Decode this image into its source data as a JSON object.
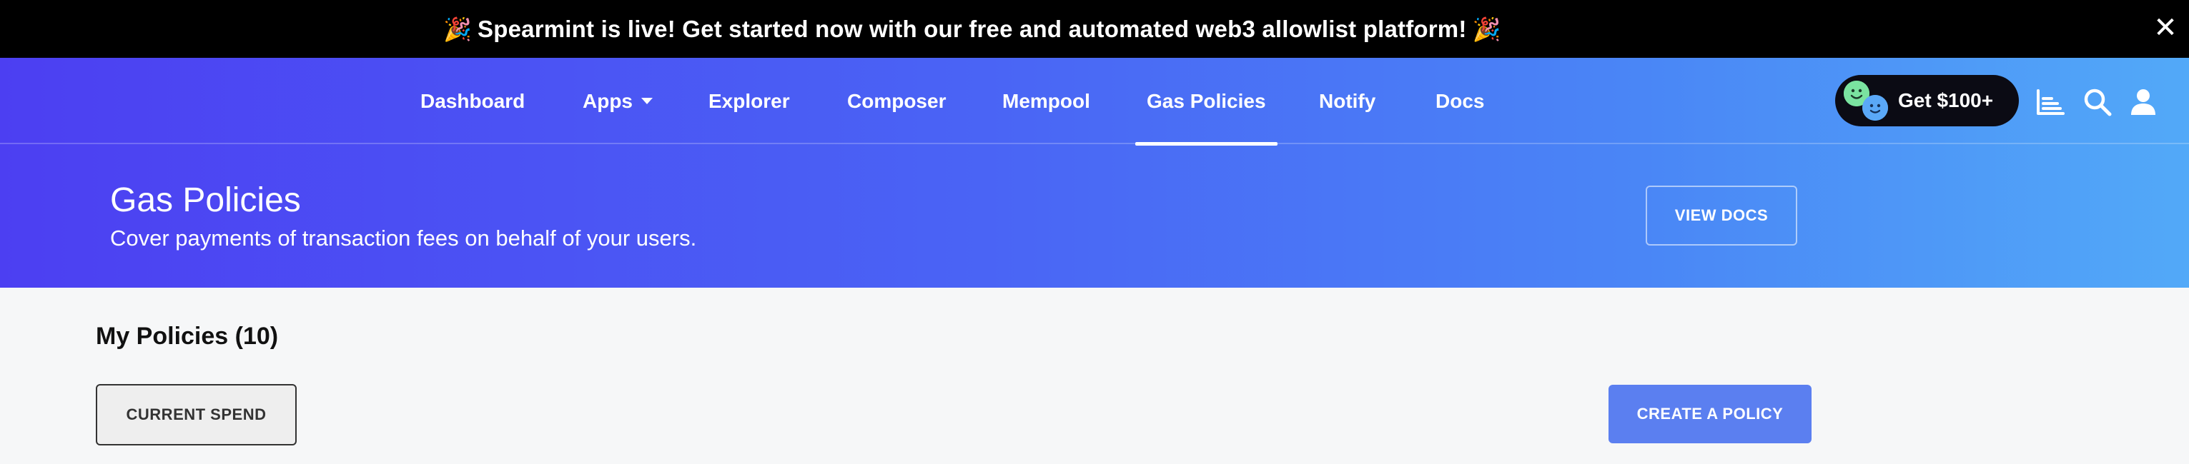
{
  "announcement": {
    "party_emoji": "🎉",
    "text": "Spearmint is live! Get started now with our free and automated web3 allowlist platform!",
    "close_glyph": "✕"
  },
  "nav": {
    "items": [
      {
        "label": "Dashboard"
      },
      {
        "label": "Apps"
      },
      {
        "label": "Explorer"
      },
      {
        "label": "Composer"
      },
      {
        "label": "Mempool"
      },
      {
        "label": "Gas Policies",
        "active": true
      },
      {
        "label": "Notify"
      },
      {
        "label": "Docs"
      }
    ],
    "promo_label": "Get $100+",
    "icons": [
      "chart-icon",
      "search-icon",
      "user-icon"
    ]
  },
  "hero": {
    "title": "Gas Policies",
    "subtitle": "Cover payments of transaction fees on behalf of your users.",
    "view_docs_label": "VIEW DOCS"
  },
  "main": {
    "section_title": "My Policies (10)",
    "current_spend_label": "CURRENT SPEND",
    "create_policy_label": "CREATE A POLICY"
  },
  "colors": {
    "gradient_start": "#4c3ff2",
    "gradient_end": "#52a9f8",
    "primary_button": "#5b7ff0",
    "page_background": "#f6f7f8"
  }
}
